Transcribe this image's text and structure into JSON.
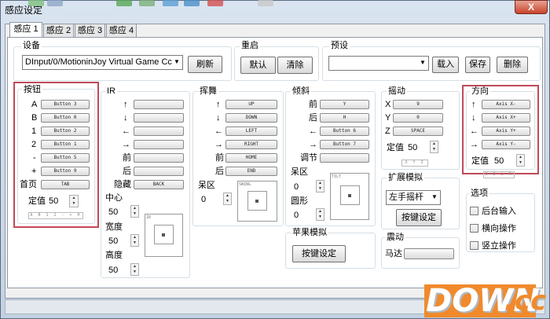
{
  "window": {
    "title": "感应设定",
    "close": "X"
  },
  "tabs": [
    "感应 1",
    "感应 2",
    "感应 3",
    "感应 4"
  ],
  "device": {
    "group": "设备",
    "selected": "DInput/0/MotioninJoy Virtual Game Cc",
    "refresh": "刷新"
  },
  "restart": {
    "group": "重启",
    "default": "默认",
    "clear": "清除"
  },
  "preset": {
    "group": "预设",
    "selected": "",
    "load": "载入",
    "save": "保存",
    "delete": "删除"
  },
  "buttons_group": {
    "title": "按钮",
    "rows": [
      {
        "label": "A",
        "value": "Button 3"
      },
      {
        "label": "B",
        "value": "Button 0"
      },
      {
        "label": "1",
        "value": "Button 2"
      },
      {
        "label": "2",
        "value": "Button 1"
      },
      {
        "label": "-",
        "value": "Button 5"
      },
      {
        "label": "+",
        "value": "Button 9"
      },
      {
        "label": "首页",
        "value": "TAB"
      }
    ],
    "threshold_label": "定值",
    "threshold_value": "50",
    "indicator": "A B 1 2 - + H"
  },
  "ir_group": {
    "title": "IR",
    "rows": [
      {
        "label": "↑",
        "value": ""
      },
      {
        "label": "↓",
        "value": ""
      },
      {
        "label": "←",
        "value": ""
      },
      {
        "label": "→",
        "value": ""
      },
      {
        "label": "前",
        "value": ""
      },
      {
        "label": "后",
        "value": ""
      },
      {
        "label": "隐藏",
        "value": "BACK"
      }
    ],
    "center_label": "中心",
    "center_value": "50",
    "width_label": "宽度",
    "width_value": "50",
    "height_label": "高度",
    "height_value": "50",
    "box_label": "IR"
  },
  "swing_group": {
    "title": "挥舞",
    "rows": [
      {
        "label": "↑",
        "value": "UP"
      },
      {
        "label": "↓",
        "value": "DOWN"
      },
      {
        "label": "←",
        "value": "LEFT"
      },
      {
        "label": "→",
        "value": "RIGHT"
      },
      {
        "label": "前",
        "value": "HOME"
      },
      {
        "label": "后",
        "value": "END"
      }
    ],
    "deadzone_label": "呆区",
    "deadzone_value": "0",
    "box_label": "SWING"
  },
  "tilt_group": {
    "title": "倾斜",
    "rows": [
      {
        "label": "前",
        "value": "Y"
      },
      {
        "label": "后",
        "value": "H"
      },
      {
        "label": "←",
        "value": "Button 6"
      },
      {
        "label": "→",
        "value": "Button 7"
      },
      {
        "label": "调节",
        "value": ""
      }
    ],
    "deadzone_label": "呆区",
    "deadzone_value": "0",
    "circle_label": "圆形",
    "circle_value": "0",
    "box_label": "TILT"
  },
  "shake_group": {
    "title": "摇动",
    "rows": [
      {
        "label": "X",
        "value": "9"
      },
      {
        "label": "Y",
        "value": "0"
      },
      {
        "label": "Z",
        "value": "SPACE"
      }
    ],
    "threshold_label": "定值",
    "threshold_value": "50",
    "indicator": "X Y Z"
  },
  "direction_group": {
    "title": "方向",
    "rows": [
      {
        "label": "↑",
        "value": "Axis X-"
      },
      {
        "label": "↓",
        "value": "Axis X+"
      },
      {
        "label": "←",
        "value": "Axis Y+"
      },
      {
        "label": "→",
        "value": "Axis Y-"
      }
    ],
    "threshold_label": "定值",
    "threshold_value": "50",
    "indicator": "U D L R"
  },
  "extension_group": {
    "title": "扩展模拟",
    "selected": "左手摇杆",
    "keyset": "按键设定"
  },
  "apple_group": {
    "title": "苹果模拟",
    "keyset": "按键设定"
  },
  "vibration_group": {
    "title": "震动",
    "motor_label": "马达"
  },
  "options_group": {
    "title": "选项",
    "items": [
      "后台输入",
      "横向操作",
      "竖立操作"
    ]
  },
  "watermark": {
    "left": "DOWN",
    "right": ".cc"
  },
  "colors": {
    "highlight": "#c04a5a",
    "brand": "#f08a2c"
  }
}
